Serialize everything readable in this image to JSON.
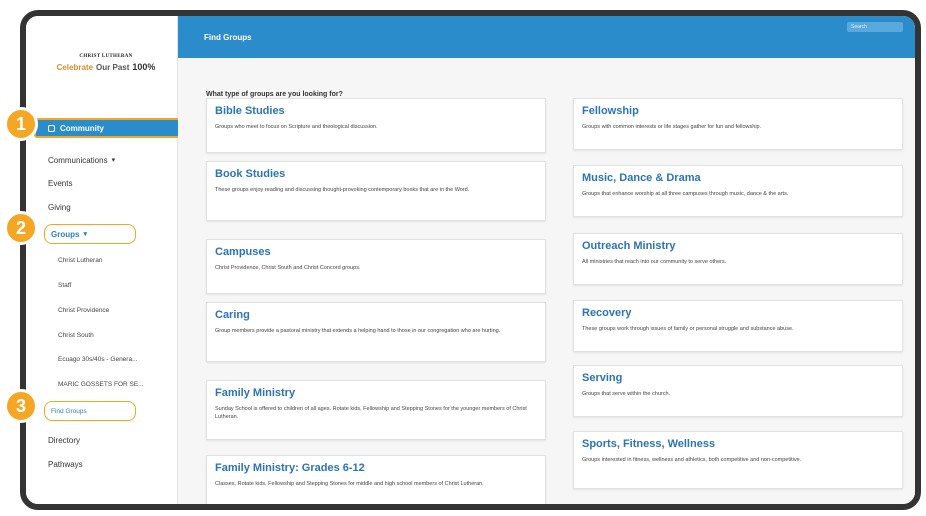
{
  "logo": {
    "line1": "CHRIST LUTHERAN",
    "word_a": "Celebrate",
    "word_b": "Our Past",
    "pct": "100%"
  },
  "sidebar": {
    "community": "Community",
    "communications": "Communications",
    "events": "Events",
    "giving": "Giving",
    "groups": "Groups",
    "sub": [
      "Christ Lutheran",
      "Staff",
      "Christ Providence",
      "Christ South",
      "Ecuago 30s/40s - Genera...",
      "MARIC GOSSETS FOR SE..."
    ],
    "find_groups": "Find Groups",
    "directory": "Directory",
    "pathways": "Pathways",
    "caret": "▾"
  },
  "topbar": {
    "title": "Find Groups",
    "search_placeholder": "Search"
  },
  "main": {
    "question": "What type of groups are you looking for?",
    "left_cards": [
      {
        "title": "Bible Studies",
        "desc": "Groups who meet to focus on Scripture and theological discussion."
      },
      {
        "title": "Book Studies",
        "desc": "These groups enjoy reading and discussing thought-provoking contemporary books that are in the Word."
      },
      {
        "title": "Campuses",
        "desc": "Christ Providence, Christ South and Christ Concord groups."
      },
      {
        "title": "Caring",
        "desc": "Group members provide a pastoral ministry that extends a helping hand to those in our congregation who are hurting."
      },
      {
        "title": "Family Ministry",
        "desc": "Sunday School is offered to children of all ages. Rotate kids, Fellowship and Stepping Stones for the younger members of Christ Lutheran."
      },
      {
        "title": "Family Ministry: Grades 6-12",
        "desc": "Classes, Rotate kids, Fellowship and Stepping Stones for middle and high school members of Christ Lutheran."
      }
    ],
    "right_cards": [
      {
        "title": "Fellowship",
        "desc": "Groups with common interests or life stages gather for fun and fellowship."
      },
      {
        "title": "Music, Dance & Drama",
        "desc": "Groups that enhance worship at all three campuses through music, dance & the arts."
      },
      {
        "title": "Outreach Ministry",
        "desc": "All ministries that reach into our community to serve others."
      },
      {
        "title": "Recovery",
        "desc": "These groups work through issues of family or personal struggle and substance abuse."
      },
      {
        "title": "Serving",
        "desc": "Groups that serve within the church."
      },
      {
        "title": "Sports, Fitness, Wellness",
        "desc": "Groups interested in fitness, wellness and athletics, both competitive and non-competitive."
      }
    ]
  },
  "badges": [
    "1",
    "2",
    "3"
  ],
  "colors": {
    "accent": "#2b8ccb",
    "highlight": "#f5a623",
    "link": "#2b74b8"
  }
}
